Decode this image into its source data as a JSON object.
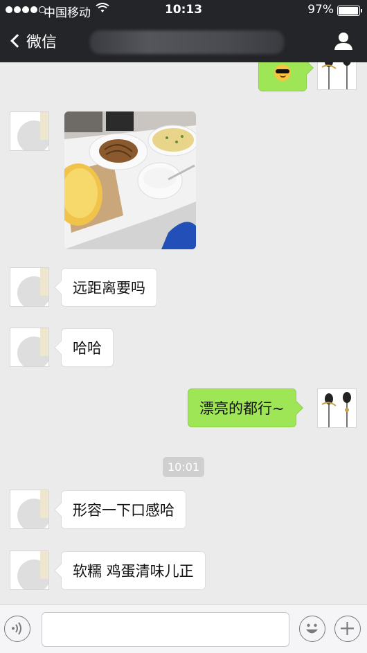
{
  "status_bar": {
    "carrier": "中国移动",
    "time": "10:13",
    "battery": "97%",
    "battery_level": 0.97
  },
  "nav": {
    "back_label": "微信"
  },
  "messages": [
    {
      "side": "left",
      "text": "远距离要吗"
    },
    {
      "side": "left",
      "text": "哈哈"
    },
    {
      "side": "right",
      "text": "漂亮的都行~"
    },
    {
      "side": "left",
      "text": "形容一下口感哈"
    },
    {
      "side": "left",
      "text": "软糯 鸡蛋清味儿正"
    }
  ],
  "timestamp": "10:01",
  "input": {
    "placeholder": ""
  },
  "icons": {
    "voice": "voice-icon",
    "emoji": "emoji-icon",
    "plus": "plus-icon",
    "person": "person-icon",
    "wifi": "wifi-icon"
  },
  "colors": {
    "nav_bg": "#242529",
    "bubble_me": "#9ee656",
    "bubble_other": "#ffffff",
    "background": "#ebebeb"
  }
}
